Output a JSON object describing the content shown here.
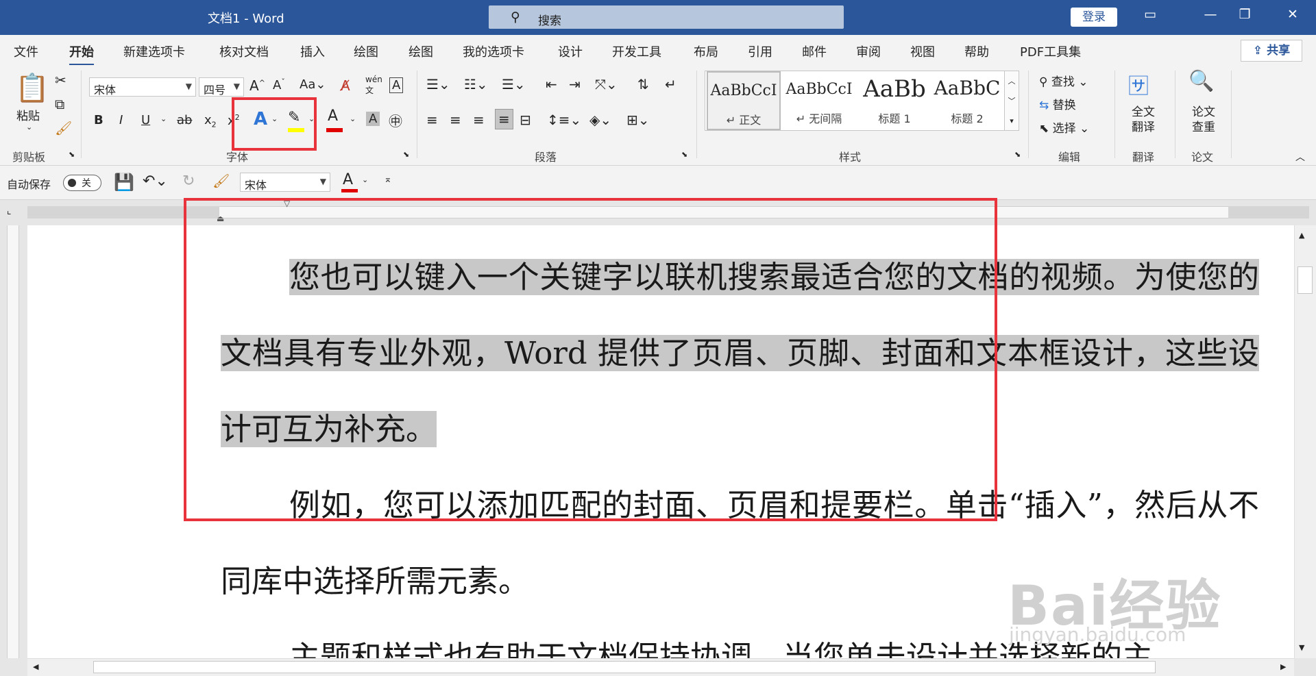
{
  "window": {
    "title": "文档1  -  Word",
    "search_placeholder": "搜索",
    "login": "登录"
  },
  "tabs": [
    "文件",
    "开始",
    "新建选项卡",
    "核对文档",
    "插入",
    "绘图",
    "绘图",
    "我的选项卡",
    "设计",
    "开发工具",
    "布局",
    "引用",
    "邮件",
    "审阅",
    "视图",
    "帮助",
    "PDF工具集"
  ],
  "active_tab": "开始",
  "share": "共享",
  "ribbon": {
    "clipboard": {
      "paste": "粘贴",
      "label": "剪贴板"
    },
    "font": {
      "name": "宋体",
      "size": "四号",
      "label": "字体"
    },
    "paragraph": {
      "label": "段落"
    },
    "styles": {
      "label": "样式",
      "items": [
        {
          "preview": "AaBbCcI",
          "name": "↵ 正文"
        },
        {
          "preview": "AaBbCcI",
          "name": "↵ 无间隔"
        },
        {
          "preview": "AaBb",
          "name": "标题 1"
        },
        {
          "preview": "AaBbC",
          "name": "标题 2"
        }
      ]
    },
    "editing": {
      "find": "查找",
      "replace": "替换",
      "select": "选择",
      "label": "编辑"
    },
    "translate": {
      "button": "全文翻译",
      "label": "翻译"
    },
    "paper": {
      "button": "论文查重",
      "label": "论文"
    }
  },
  "qat": {
    "autosave": "自动保存",
    "toggle": "关",
    "font": "宋体"
  },
  "document": {
    "para1_highlighted": "您也可以键入一个关键字以联机搜索最适合您的文档的视频。为使您的文档具有专业外观，Word 提供了页眉、页脚、封面和文本框设计，这些设计可互为补充。",
    "para2": "例如，您可以添加匹配的封面、页眉和提要栏。单击“插入”，然后从不同库中选择所需元素。",
    "para3": "主题和样式也有助于文档保持协调。当您单击设计并选择新的主"
  },
  "watermark": {
    "brand": "Bai经验",
    "url": "jingyan.baidu.com"
  },
  "colors": {
    "titlebar": "#2b579a",
    "highlight": "#c8c8c8",
    "annotation": "#e8323c",
    "font_color": "#e00000",
    "highlighter": "#ffff00"
  }
}
